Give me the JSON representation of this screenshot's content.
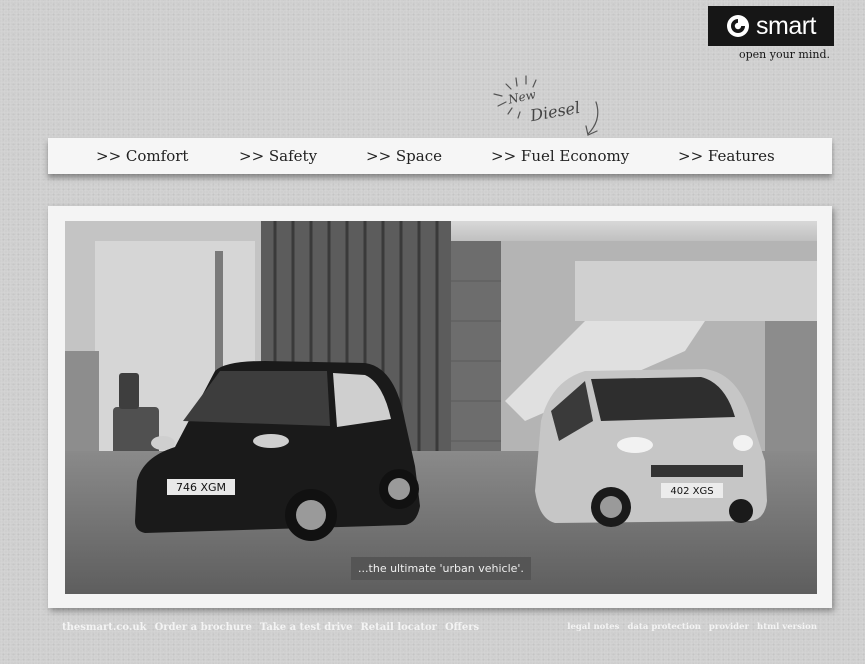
{
  "brand": {
    "logo_word": "smart",
    "tagline": "open your mind."
  },
  "annotation": {
    "line1": "New",
    "line2": "Diesel"
  },
  "nav": {
    "items": [
      {
        "label": ">> Comfort"
      },
      {
        "label": ">> Safety"
      },
      {
        "label": ">> Space"
      },
      {
        "label": ">> Fuel Economy"
      },
      {
        "label": ">> Features"
      }
    ]
  },
  "hero": {
    "caption": "...the ultimate 'urban vehicle'.",
    "plate_left": "746 XGM",
    "plate_right": "402 XGS"
  },
  "footer": {
    "left_links": [
      "thesmart.co.uk",
      "Order a brochure",
      "Take a test drive",
      "Retail locator",
      "Offers"
    ],
    "right_links": [
      "legal notes",
      "data protection",
      "provider",
      "html version"
    ]
  },
  "colors": {
    "page_bg": "#cfcfcf",
    "logo_bg": "#161616",
    "nav_bg": "#f6f6f6",
    "caption_bg": "#555555"
  }
}
